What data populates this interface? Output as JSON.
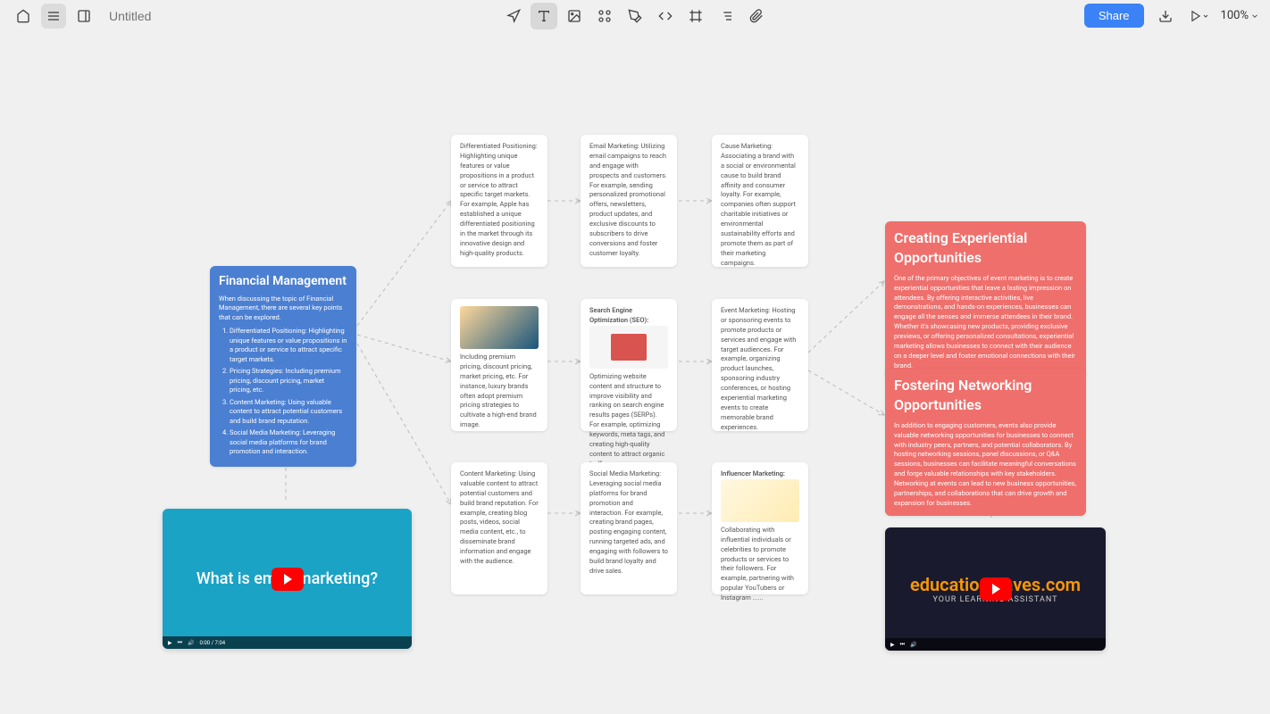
{
  "header": {
    "title_placeholder": "Untitled",
    "share_label": "Share",
    "zoom_level": "100%"
  },
  "cards": {
    "financial": {
      "title": "Financial Management",
      "intro": "When discussing the topic of Financial Management, there are several key points that can be explored.",
      "items": [
        "Differentiated Positioning: Highlighting unique features or value propositions in a product or service to attract specific target markets.",
        "Pricing Strategies: Including premium pricing, discount pricing, market pricing, etc.",
        "Content Marketing: Using valuable content to attract potential customers and build brand reputation.",
        "Social Media Marketing: Leveraging social media platforms for brand promotion and interaction."
      ]
    },
    "differentiated": {
      "text": "Differentiated Positioning: Highlighting unique features or value propositions in a product or service to attract specific target markets. For example, Apple has established a unique differentiated positioning in the market through its innovative design and high-quality products."
    },
    "email": {
      "text": "Email Marketing: Utilizing email campaigns to reach and engage with prospects and customers. For example, sending personalized promotional offers, newsletters, product updates, and exclusive discounts to subscribers to drive conversions and foster customer loyalty."
    },
    "cause": {
      "text": "Cause Marketing: Associating a brand with a social or environmental cause to build brand affinity and consumer loyalty. For example, companies often support charitable initiatives or environmental sustainability efforts and promote them as part of their marketing campaigns."
    },
    "pricing": {
      "text": "Including premium pricing, discount pricing, market pricing, etc. For instance, luxury brands often adopt premium pricing strategies to cultivate a high-end brand image."
    },
    "seo": {
      "title": "Search Engine Optimization (SEO):",
      "text": "Optimizing website content and structure to improve visibility and ranking on search engine results pages (SERPs). For example, optimizing keywords, meta tags, and creating high-quality content to attract organic traffic ......"
    },
    "event": {
      "text": "Event Marketing: Hosting or sponsoring events to promote products or services and engage with target audiences. For example, organizing product launches, sponsoring industry conferences, or hosting experiential marketing events to create memorable brand experiences."
    },
    "content": {
      "text": "Content Marketing: Using valuable content to attract potential customers and build brand reputation. For example, creating blog posts, videos, social media content, etc., to disseminate brand information and engage with the audience."
    },
    "social": {
      "text": "Social Media Marketing: Leveraging social media platforms for brand promotion and interaction. For example, creating brand pages, posting engaging content, running targeted ads, and engaging with followers to build brand loyalty and drive sales."
    },
    "influencer": {
      "title": "Influencer Marketing:",
      "text": "Collaborating with influential individuals or celebrities to promote products or services to their followers. For example, partnering with popular YouTubers or Instagram ......"
    },
    "experiential": {
      "title": "Creating Experiential Opportunities",
      "text": "One of the primary objectives of event marketing is to create experiential opportunities that leave a lasting impression on attendees. By offering interactive activities, live demonstrations, and hands-on experiences, businesses can engage all the senses and immerse attendees in their brand. Whether it's showcasing new products, providing exclusive previews, or offering personalized consultations, experiential marketing allows businesses to connect with their audience on a deeper level and foster emotional connections with their brand."
    },
    "networking": {
      "title": "Fostering Networking Opportunities",
      "text": "In addition to engaging customers, events also provide valuable networking opportunities for businesses to connect with industry peers, partners, and potential collaborators. By hosting networking sessions, panel discussions, or Q&A sessions, businesses can facilitate meaningful conversations and forge valuable relationships with key stakeholders. Networking at events can lead to new business opportunities, partnerships, and collaborations that can drive growth and expansion for businesses."
    }
  },
  "videos": {
    "blue": {
      "title": "What is email marketing?",
      "duration": "0:00 / 7:04"
    },
    "dark": {
      "title": "educationleaves.com",
      "subtitle": "YOUR LEARNING ASSISTANT"
    }
  }
}
